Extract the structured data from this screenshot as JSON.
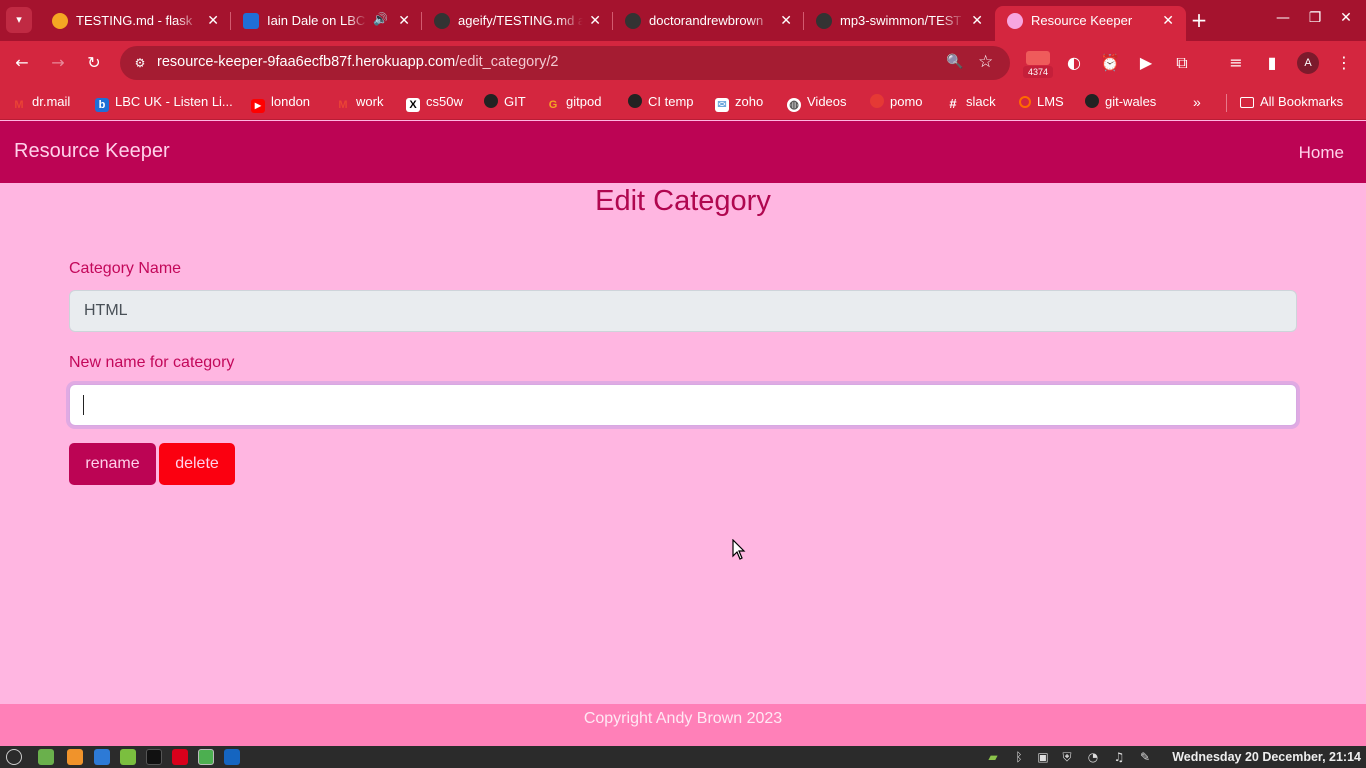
{
  "browser": {
    "tabs": [
      {
        "title": "TESTING.md - flask",
        "fav_color": "#f5a623"
      },
      {
        "title": "Iain Dale on LBC |",
        "fav_color": "#1f6fd6"
      },
      {
        "title": "ageify/TESTING.md a",
        "fav_color": "#333333"
      },
      {
        "title": "doctorandrewbrown",
        "fav_color": "#333333"
      },
      {
        "title": "mp3-swimmon/TEST",
        "fav_color": "#333333"
      },
      {
        "title": "Resource Keeper",
        "fav_color": "#f7a6e0"
      }
    ],
    "url_host": "resource-keeper-9faa6ecfb87f.herokuapp.com",
    "url_path": "/edit_category/2",
    "extension_badge": "4374",
    "profile_initial": "A",
    "bookmarks": [
      {
        "label": "dr.mail",
        "icon": "gmail-icon",
        "color": "#ea4335",
        "glyph": "M"
      },
      {
        "label": "LBC UK - Listen Li...",
        "icon": "lbc-icon",
        "color": "#1f6fd6",
        "glyph": "b"
      },
      {
        "label": "london",
        "icon": "youtube-icon",
        "color": "#ff0000",
        "glyph": "▶"
      },
      {
        "label": "work",
        "icon": "gmail-icon",
        "color": "#ea4335",
        "glyph": "M"
      },
      {
        "label": "cs50w",
        "icon": "x-icon",
        "color": "#000000",
        "glyph": "X"
      },
      {
        "label": "GIT",
        "icon": "github-icon",
        "color": "#222222",
        "glyph": "●"
      },
      {
        "label": "gitpod",
        "icon": "gitpod-icon",
        "color": "#f5a623",
        "glyph": "G"
      },
      {
        "label": "CI temp",
        "icon": "github-icon",
        "color": "#222222",
        "glyph": "●"
      },
      {
        "label": "zoho",
        "icon": "zoho-icon",
        "color": "#6fa8dc",
        "glyph": "✉"
      },
      {
        "label": "Videos",
        "icon": "globe-icon",
        "color": "#555555",
        "glyph": "◍"
      },
      {
        "label": "pomo",
        "icon": "tomato-icon",
        "color": "#e53935",
        "glyph": "●"
      },
      {
        "label": "slack",
        "icon": "slack-icon",
        "color": "#4a154b",
        "glyph": "#"
      },
      {
        "label": "LMS",
        "icon": "lms-icon",
        "color": "#ff6a00",
        "glyph": "O"
      },
      {
        "label": "git-wales",
        "icon": "github-icon",
        "color": "#222222",
        "glyph": "●"
      }
    ],
    "all_bookmarks_label": "All Bookmarks"
  },
  "page": {
    "brand": "Resource Keeper",
    "nav_home": "Home",
    "title": "Edit Category",
    "category_name_label": "Category Name",
    "category_name_value": "HTML",
    "new_name_label": "New name for category",
    "new_name_value": "",
    "rename_label": "rename",
    "delete_label": "delete",
    "footer": "Copyright Andy Brown 2023"
  },
  "taskbar": {
    "clock": "Wednesday 20 December, 21:14"
  },
  "colors": {
    "navbar": "#bc0454",
    "page_bg": "#ffb6e1",
    "footer_bg": "#ff80b8",
    "delete_btn": "#fb0010",
    "browser_frame": "#a5132e"
  }
}
